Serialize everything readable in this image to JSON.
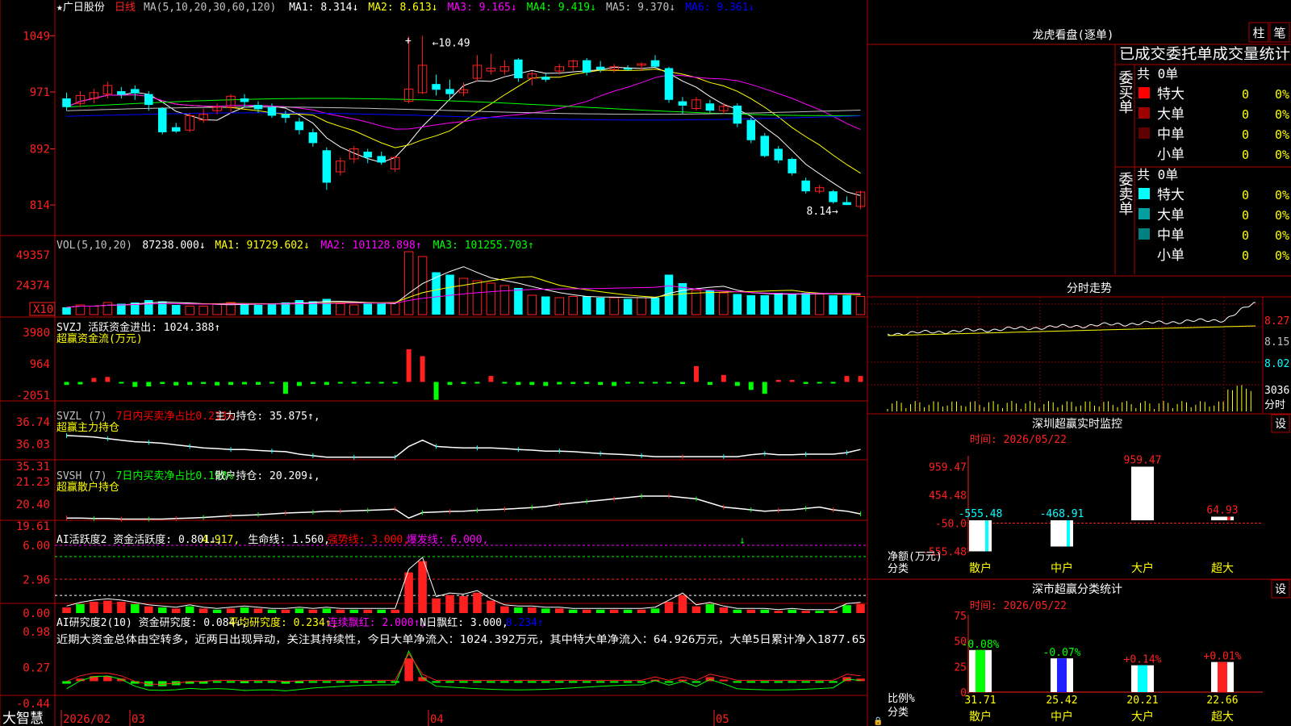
{
  "stock": {
    "name": "★广日股份",
    "period": "日线"
  },
  "header_main": [
    {
      "text": "MA(5,10,20,30,60,120)",
      "color": "#c0c0c0"
    },
    {
      "text": "MA1: 8.314↓",
      "color": "#ffffff"
    },
    {
      "text": "MA2: 8.613↓",
      "color": "#ffff00"
    },
    {
      "text": "MA3: 9.165↓",
      "color": "#ff00ff"
    },
    {
      "text": "MA4: 9.419↓",
      "color": "#00ff00"
    },
    {
      "text": "MA5: 9.370↓",
      "color": "#c0c0c0"
    },
    {
      "text": "MA6: 9.361↓",
      "color": "#0000ff"
    }
  ],
  "header_vol": [
    {
      "text": "VOL(5,10,20)",
      "color": "#c0c0c0"
    },
    {
      "text": "87238.000↓",
      "color": "#ffffff"
    },
    {
      "text": "MA1: 91729.602↓",
      "color": "#ffff00"
    },
    {
      "text": "MA2: 101128.898↑",
      "color": "#ff00ff"
    },
    {
      "text": "MA3: 101255.703↑",
      "color": "#00ff00"
    }
  ],
  "header_svzj": [
    {
      "text": "SVZJ  活跃资金进出: 1024.388↑",
      "color": "#ffffff"
    }
  ],
  "sub_svzj": "超赢资金流(万元)",
  "header_svzl": [
    {
      "text": "SVZL (7)",
      "color": "#c0c0c0"
    },
    {
      "text": "7日内买卖净占比0.213%",
      "color": "#ff0000"
    },
    {
      "text": "主力持仓: 35.875↑,",
      "color": "#ffffff"
    }
  ],
  "sub_svzl": "超赢主力持仓",
  "header_svsh": [
    {
      "text": "SVSH (7)",
      "color": "#c0c0c0"
    },
    {
      "text": "7日内买卖净占比0.198%",
      "color": "#00ff00"
    },
    {
      "text": "散户持仓: 20.209↓,",
      "color": "#ffffff"
    }
  ],
  "sub_svsh": "超赢散户持仓",
  "header_ai1": [
    {
      "text": "AI活跃度2 资金活跃度: 0.801↓,",
      "color": "#ffffff"
    },
    {
      "text": "4.917,",
      "color": "#ffff00"
    },
    {
      "text": "生命线: 1.560,",
      "color": "#ffffff"
    },
    {
      "text": "强势线: 3.000,",
      "color": "#ff0000"
    },
    {
      "text": "爆发线: 6.000,",
      "color": "#ff00ff"
    }
  ],
  "header_ai2": [
    {
      "text": "AI研究度2(10) 资金研究度: 0.084↓,",
      "color": "#ffffff"
    },
    {
      "text": "平均研究度: 0.234↑,",
      "color": "#ffff00"
    },
    {
      "text": "连续飘红: 2.000↑,",
      "color": "#ff00ff"
    },
    {
      "text": "N日飘红: 3.000,",
      "color": "#ffffff"
    },
    {
      "text": "0.234↑",
      "color": "#0000ff"
    }
  ],
  "comment": "近期大资金总体由空转多，近两日出现异动，关注其持续性，今日大单净流入：1024.392万元，其中特大单净流入：64.926万元，大单5日累计净入1877.65",
  "bottom": {
    "logo": "大智慧",
    "date_labels": [
      "2026/02",
      "03",
      "04",
      "05"
    ]
  },
  "right_panel": {
    "title": "龙虎看盘(逐单)",
    "buttons": [
      "柱",
      "笔"
    ],
    "section_title": "已成交委托单成交量统计",
    "buy_label": "委买单",
    "sell_label": "委卖单",
    "buy_total": "共 0单",
    "sell_total": "共 0单",
    "buy_rows": [
      {
        "label": "特大",
        "count": "0",
        "pct": "0%",
        "color": "#ff0000"
      },
      {
        "label": "大单",
        "count": "0",
        "pct": "0%",
        "color": "#a00000"
      },
      {
        "label": "中单",
        "count": "0",
        "pct": "0%",
        "color": "#600000"
      },
      {
        "label": "小单",
        "count": "0",
        "pct": "0%",
        "color": "#000000"
      }
    ],
    "sell_rows": [
      {
        "label": "特大",
        "count": "0",
        "pct": "0%",
        "color": "#00ffff"
      },
      {
        "label": "大单",
        "count": "0",
        "pct": "0%",
        "color": "#00a0a0"
      },
      {
        "label": "中单",
        "count": "0",
        "pct": "0%",
        "color": "#008080"
      },
      {
        "label": "小单",
        "count": "0",
        "pct": "0%",
        "color": "#000000"
      }
    ],
    "intraday_title": "分时走势",
    "intraday_prices": [
      "8.27",
      "8.15",
      "8.02"
    ],
    "intraday_vol": "3036",
    "intraday_label": "分时",
    "monitor_title": "深圳超赢实时监控",
    "monitor_button": "设",
    "monitor_time": "时间: 2026/05/22",
    "monitor_axis": [
      "959.47",
      "454.48",
      "-50.0",
      "-555.48"
    ],
    "monitor_axis_label": "净额(万元)",
    "monitor_cat_label": "分类",
    "classify_title": "深市超赢分类统计",
    "classify_button": "设",
    "classify_time": "时间: 2026/05/22",
    "classify_axis": [
      "75",
      "50",
      "25",
      "0"
    ],
    "classify_axis_label": "比例%",
    "classify_cat_label": "分类"
  },
  "chart_data": [
    {
      "type": "candlestick",
      "title": "广日股份 日线",
      "ylim": [
        7.94,
        10.74
      ],
      "y_ticks": [
        "1049",
        "971",
        "892",
        "814"
      ],
      "high_annotation": "10.49",
      "low_annotation": "8.14",
      "candles": [
        {
          "o": 9.62,
          "c": 9.5,
          "h": 9.7,
          "l": 9.45
        },
        {
          "o": 9.55,
          "c": 9.66,
          "h": 9.72,
          "l": 9.5
        },
        {
          "o": 9.62,
          "c": 9.7,
          "h": 9.75,
          "l": 9.55
        },
        {
          "o": 9.68,
          "c": 9.8,
          "h": 9.85,
          "l": 9.62
        },
        {
          "o": 9.72,
          "c": 9.67,
          "h": 9.78,
          "l": 9.62
        },
        {
          "o": 9.75,
          "c": 9.69,
          "h": 9.8,
          "l": 9.6
        },
        {
          "o": 9.68,
          "c": 9.53,
          "h": 9.72,
          "l": 9.45
        },
        {
          "o": 9.48,
          "c": 9.15,
          "h": 9.5,
          "l": 9.12
        },
        {
          "o": 9.22,
          "c": 9.16,
          "h": 9.28,
          "l": 9.14
        },
        {
          "o": 9.18,
          "c": 9.38,
          "h": 9.42,
          "l": 9.15
        },
        {
          "o": 9.32,
          "c": 9.4,
          "h": 9.48,
          "l": 9.28
        },
        {
          "o": 9.45,
          "c": 9.5,
          "h": 9.55,
          "l": 9.4
        },
        {
          "o": 9.5,
          "c": 9.65,
          "h": 9.68,
          "l": 9.42
        },
        {
          "o": 9.62,
          "c": 9.57,
          "h": 9.68,
          "l": 9.5
        },
        {
          "o": 9.53,
          "c": 9.47,
          "h": 9.58,
          "l": 9.42
        },
        {
          "o": 9.5,
          "c": 9.38,
          "h": 9.55,
          "l": 9.35
        },
        {
          "o": 9.4,
          "c": 9.35,
          "h": 9.45,
          "l": 9.28
        },
        {
          "o": 9.3,
          "c": 9.18,
          "h": 9.35,
          "l": 9.12
        },
        {
          "o": 9.15,
          "c": 9.0,
          "h": 9.2,
          "l": 8.95
        },
        {
          "o": 8.9,
          "c": 8.45,
          "h": 8.94,
          "l": 8.35
        },
        {
          "o": 8.6,
          "c": 8.75,
          "h": 8.8,
          "l": 8.55
        },
        {
          "o": 8.78,
          "c": 8.92,
          "h": 8.96,
          "l": 8.72
        },
        {
          "o": 8.88,
          "c": 8.8,
          "h": 8.92,
          "l": 8.72
        },
        {
          "o": 8.82,
          "c": 8.73,
          "h": 8.88,
          "l": 8.7
        },
        {
          "o": 8.64,
          "c": 8.8,
          "h": 8.82,
          "l": 8.6
        },
        {
          "o": 9.58,
          "c": 9.75,
          "h": 10.48,
          "l": 9.55
        },
        {
          "o": 9.7,
          "c": 10.08,
          "h": 10.49,
          "l": 9.68
        },
        {
          "o": 9.82,
          "c": 9.74,
          "h": 9.95,
          "l": 9.66
        },
        {
          "o": 9.75,
          "c": 9.68,
          "h": 9.88,
          "l": 9.62
        },
        {
          "o": 9.7,
          "c": 9.74,
          "h": 9.84,
          "l": 9.65
        },
        {
          "o": 9.9,
          "c": 10.08,
          "h": 10.22,
          "l": 9.85
        },
        {
          "o": 10.0,
          "c": 10.04,
          "h": 10.24,
          "l": 9.95
        },
        {
          "o": 10.0,
          "c": 10.06,
          "h": 10.15,
          "l": 9.95
        },
        {
          "o": 10.16,
          "c": 9.9,
          "h": 10.18,
          "l": 9.85
        },
        {
          "o": 9.9,
          "c": 9.96,
          "h": 10.0,
          "l": 9.8
        },
        {
          "o": 9.92,
          "c": 9.88,
          "h": 9.98,
          "l": 9.85
        },
        {
          "o": 10.0,
          "c": 10.06,
          "h": 10.1,
          "l": 9.95
        },
        {
          "o": 10.06,
          "c": 10.14,
          "h": 10.16,
          "l": 10.0
        },
        {
          "o": 10.15,
          "c": 9.98,
          "h": 10.18,
          "l": 9.94
        },
        {
          "o": 10.06,
          "c": 10.02,
          "h": 10.14,
          "l": 9.98
        },
        {
          "o": 10.02,
          "c": 10.06,
          "h": 10.1,
          "l": 9.98
        },
        {
          "o": 10.04,
          "c": 10.02,
          "h": 10.08,
          "l": 10.0
        },
        {
          "o": 10.08,
          "c": 10.1,
          "h": 10.12,
          "l": 10.0
        },
        {
          "o": 10.15,
          "c": 10.06,
          "h": 10.22,
          "l": 10.04
        },
        {
          "o": 10.04,
          "c": 9.6,
          "h": 10.06,
          "l": 9.56
        },
        {
          "o": 9.58,
          "c": 9.52,
          "h": 9.64,
          "l": 9.4
        },
        {
          "o": 9.48,
          "c": 9.6,
          "h": 9.64,
          "l": 9.45
        },
        {
          "o": 9.55,
          "c": 9.45,
          "h": 9.6,
          "l": 9.42
        },
        {
          "o": 9.45,
          "c": 9.51,
          "h": 9.56,
          "l": 9.4
        },
        {
          "o": 9.52,
          "c": 9.27,
          "h": 9.55,
          "l": 9.22
        },
        {
          "o": 9.32,
          "c": 9.04,
          "h": 9.35,
          "l": 9.0
        },
        {
          "o": 9.1,
          "c": 8.82,
          "h": 9.14,
          "l": 8.8
        },
        {
          "o": 8.92,
          "c": 8.76,
          "h": 8.96,
          "l": 8.72
        },
        {
          "o": 8.78,
          "c": 8.58,
          "h": 8.8,
          "l": 8.55
        },
        {
          "o": 8.48,
          "c": 8.33,
          "h": 8.52,
          "l": 8.3
        },
        {
          "o": 8.33,
          "c": 8.38,
          "h": 8.42,
          "l": 8.3
        },
        {
          "o": 8.33,
          "c": 8.18,
          "h": 8.35,
          "l": 8.16
        },
        {
          "o": 8.18,
          "c": 8.14,
          "h": 8.26,
          "l": 8.14
        },
        {
          "o": 8.12,
          "c": 8.32,
          "h": 8.34,
          "l": 8.08
        }
      ]
    },
    {
      "type": "bar",
      "title": "VOL",
      "ylim": [
        0,
        60000
      ],
      "y_ticks": [
        "49357",
        "24374"
      ],
      "unit_label": "X10",
      "values": [
        6000,
        8000,
        7000,
        10000,
        9000,
        10000,
        12000,
        11000,
        8000,
        7000,
        7000,
        9000,
        10000,
        9000,
        8000,
        9000,
        10000,
        12000,
        11000,
        13000,
        9000,
        8000,
        9000,
        9000,
        10000,
        52000,
        48000,
        35000,
        33000,
        30000,
        28000,
        26000,
        24000,
        22000,
        16000,
        15000,
        14000,
        15000,
        15000,
        14000,
        14000,
        13000,
        14000,
        14000,
        33000,
        26000,
        20000,
        20000,
        18000,
        17000,
        16000,
        16000,
        18000,
        17000,
        18000,
        17000,
        16000,
        16000,
        15000
      ]
    },
    {
      "type": "bar",
      "title": "SVZJ",
      "ylim": [
        -2051,
        3980
      ],
      "y_ticks": [
        "3980",
        "964",
        "-2051"
      ],
      "values": [
        -300,
        -250,
        400,
        500,
        -150,
        -500,
        -450,
        -200,
        -350,
        -300,
        -200,
        -350,
        -300,
        -250,
        -280,
        -150,
        -1200,
        -400,
        -200,
        -300,
        -150,
        -100,
        -120,
        -90,
        -100,
        3300,
        2600,
        -1800,
        -300,
        -200,
        -150,
        600,
        -150,
        -300,
        -300,
        -400,
        -250,
        -200,
        -200,
        -300,
        -400,
        -150,
        -100,
        -120,
        -100,
        -200,
        1600,
        -300,
        700,
        -400,
        -800,
        -1200,
        200,
        200,
        -200,
        -150,
        -100,
        600,
        600
      ]
    },
    {
      "type": "line",
      "title": "SVZL",
      "ylim": [
        35.31,
        36.74
      ],
      "y_ticks": [
        "36.74",
        "36.03",
        "35.31"
      ]
    },
    {
      "type": "line",
      "title": "SVSH",
      "ylim": [
        19.61,
        21.23
      ],
      "y_ticks": [
        "21.23",
        "20.40",
        "19.61"
      ]
    },
    {
      "type": "bar",
      "title": "AI活跃度2",
      "ylim": [
        0,
        6
      ],
      "y_ticks": [
        "6.00",
        "2.96",
        "0.00"
      ],
      "values": [
        0.5,
        0.8,
        1.0,
        1.1,
        1.0,
        0.8,
        0.6,
        0.5,
        0.4,
        0.6,
        0.4,
        0.3,
        0.4,
        0.5,
        0.4,
        0.3,
        0.3,
        0.4,
        0.3,
        0.4,
        0.3,
        0.3,
        0.3,
        0.3,
        0.3,
        3.6,
        4.6,
        1.3,
        1.6,
        1.5,
        1.8,
        1.1,
        0.6,
        0.5,
        0.5,
        0.4,
        0.4,
        0.3,
        0.3,
        0.3,
        0.3,
        0.3,
        0.3,
        0.4,
        1.0,
        1.6,
        0.6,
        0.8,
        0.5,
        0.3,
        0.3,
        0.3,
        0.2,
        0.3,
        0.2,
        0.2,
        0.2,
        0.7,
        0.8
      ]
    },
    {
      "type": "bar",
      "title": "AI研究度2",
      "ylim": [
        -0.44,
        0.98
      ],
      "y_ticks": [
        "0.98",
        "0.27",
        "-0.44"
      ],
      "values": [
        -0.05,
        0.05,
        0.1,
        0.1,
        0.05,
        -0.05,
        -0.1,
        -0.1,
        -0.08,
        -0.05,
        -0.05,
        -0.03,
        -0.03,
        -0.04,
        -0.03,
        -0.03,
        -0.05,
        -0.04,
        -0.03,
        -0.03,
        -0.03,
        -0.03,
        -0.03,
        -0.03,
        -0.03,
        0.45,
        0.08,
        -0.03,
        -0.03,
        -0.03,
        -0.03,
        -0.03,
        -0.03,
        -0.03,
        -0.03,
        -0.03,
        -0.03,
        -0.03,
        -0.03,
        -0.03,
        -0.03,
        -0.03,
        -0.03,
        0.03,
        -0.03,
        0.03,
        -0.03,
        0.08,
        0.03,
        -0.03,
        -0.03,
        -0.03,
        -0.03,
        -0.03,
        -0.03,
        -0.03,
        -0.03,
        0.08,
        0.05
      ]
    },
    {
      "type": "bar",
      "title": "深圳超赢实时监控",
      "categories": [
        "散户",
        "中户",
        "大户",
        "超大"
      ],
      "values": [
        -555.48,
        -468.91,
        959.47,
        64.93
      ],
      "labels": [
        "-555.48",
        "-468.91",
        "959.47",
        "64.93"
      ],
      "ylim": [
        -555.48,
        959.47
      ]
    },
    {
      "type": "bar",
      "title": "深市超赢分类统计",
      "categories": [
        "散户",
        "中户",
        "大户",
        "超大"
      ],
      "values": [
        31.71,
        25.42,
        20.21,
        22.66
      ],
      "value_labels": [
        "31.71",
        "25.42",
        "20.21",
        "22.66"
      ],
      "change_labels": [
        "-0.08%",
        "-0.07%",
        "+0.14%",
        "+0.01%"
      ],
      "ylim": [
        0,
        75
      ]
    }
  ]
}
